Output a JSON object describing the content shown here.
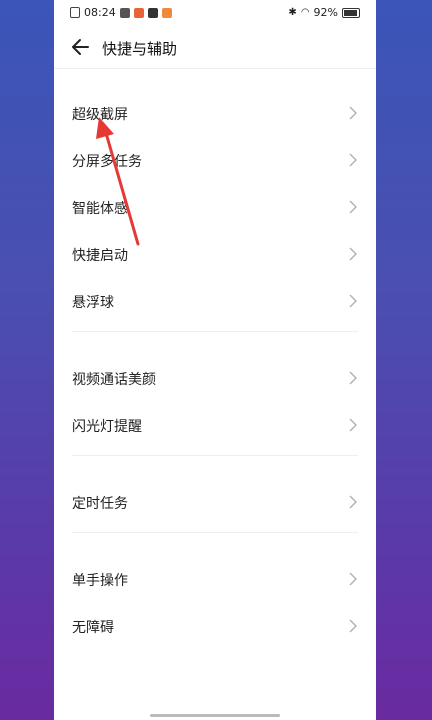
{
  "statusbar": {
    "time": "08:24",
    "icons": [
      "sim-icon",
      "app-notification-icon-1",
      "app-notification-icon-2",
      "app-notification-icon-3"
    ],
    "battery_percent": "92%",
    "battery_level": 0.92
  },
  "header": {
    "title": "快捷与辅助"
  },
  "groups": [
    {
      "items": [
        "超级截屏",
        "分屏多任务",
        "智能体感",
        "快捷启动",
        "悬浮球"
      ]
    },
    {
      "items": [
        "视频通话美颜",
        "闪光灯提醒"
      ]
    },
    {
      "items": [
        "定时任务"
      ]
    },
    {
      "items": [
        "单手操作",
        "无障碍"
      ]
    }
  ],
  "colors": {
    "background_gradient_top": "#3b55b8",
    "background_gradient_bottom": "#6a2aa0",
    "annotation_arrow": "#e53935"
  }
}
